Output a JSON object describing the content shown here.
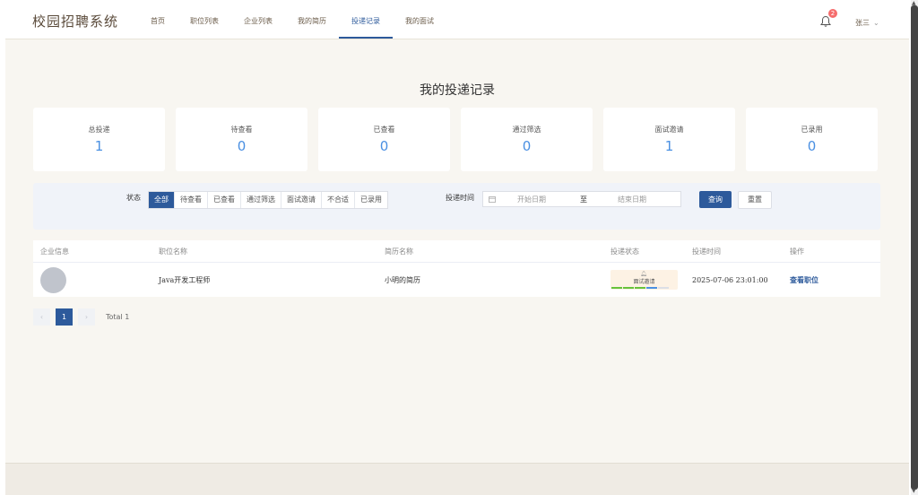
{
  "header": {
    "logo": "校园招聘系统",
    "nav": [
      "首页",
      "职位列表",
      "企业列表",
      "我的简历",
      "投递记录",
      "我的面试"
    ],
    "active_nav": 4,
    "notification_count": "2",
    "user_name": "张三"
  },
  "page_title": "我的投递记录",
  "stats": [
    {
      "label": "总投递",
      "value": "1"
    },
    {
      "label": "待查看",
      "value": "0"
    },
    {
      "label": "已查看",
      "value": "0"
    },
    {
      "label": "通过筛选",
      "value": "0"
    },
    {
      "label": "面试邀请",
      "value": "1"
    },
    {
      "label": "已录用",
      "value": "0"
    }
  ],
  "filter": {
    "status_label": "状态",
    "status_options": [
      "全部",
      "待查看",
      "已查看",
      "通过筛选",
      "面试邀请",
      "不合适",
      "已录用"
    ],
    "selected_status": "全部",
    "time_label": "投递时间",
    "start_placeholder": "开始日期",
    "range_separator": "至",
    "end_placeholder": "结束日期",
    "query_button": "查询",
    "reset_button": "重置"
  },
  "table": {
    "columns": [
      "企业信息",
      "职位名称",
      "简历名称",
      "投递状态",
      "投递时间",
      "操作"
    ],
    "rows": [
      {
        "position": "Java开发工程师",
        "resume": "小明的简历",
        "status": "面试邀请",
        "time": "2025-07-06 23:01:00",
        "action": "查看职位"
      }
    ]
  },
  "pagination": {
    "current_page": "1",
    "total": "Total 1"
  },
  "colors": {
    "primary": "#2d5a9b",
    "stat_value": "#4a90e2",
    "badge": "#f56c6c",
    "progress": [
      "#67c23a",
      "#67c23a",
      "#67c23a",
      "#4a90e2",
      "#dcdfe6"
    ]
  }
}
